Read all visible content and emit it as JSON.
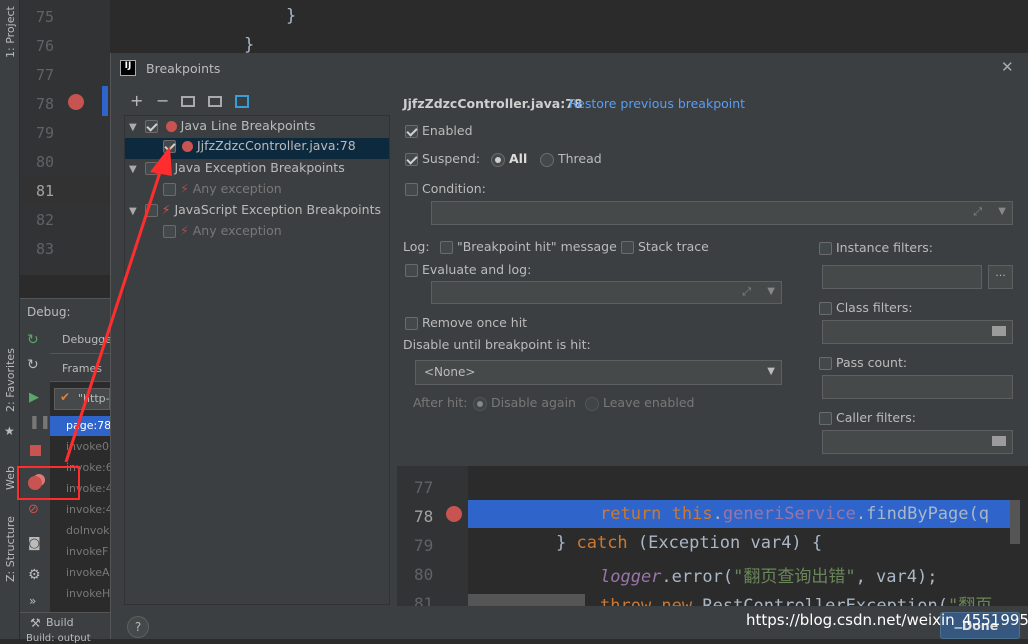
{
  "ide": {
    "left_tabs": [
      "1: Project",
      "2: Favorites",
      "Web",
      "Z: Structure"
    ],
    "gutter_lines": [
      "75",
      "76",
      "77",
      "78",
      "79",
      "80",
      "81",
      "82",
      "83"
    ],
    "editor_lines": [
      "}",
      "}"
    ],
    "debug_label": "Debug:",
    "debug_tabs": [
      "Debugger",
      "Frames"
    ],
    "thread": "\"http-",
    "frames": [
      "page:78",
      "invoke0",
      "invoke:6",
      "invoke:4",
      "invoke:4",
      "doInvok",
      "invokeF",
      "invokeA",
      "invokeH"
    ],
    "bottom": {
      "build": "Build",
      "build_out": "Build: output"
    }
  },
  "dialog": {
    "title": "Breakpoints",
    "toolbar": [
      "+",
      "−"
    ],
    "tree": [
      {
        "label": "Java Line Breakpoints",
        "checked": true
      },
      {
        "label": "JjfzZdzcController.java:78",
        "checked": true,
        "selected": true
      },
      {
        "label": "Java Exception Breakpoints",
        "checked": false
      },
      {
        "label": "Any exception",
        "checked": false
      },
      {
        "label": "JavaScript Exception Breakpoints",
        "checked": false
      },
      {
        "label": "Any exception",
        "checked": false
      }
    ],
    "header_file": "JjfzZdzcController.java:78",
    "restore_link": "Restore previous breakpoint",
    "enabled": "Enabled",
    "suspend": "Suspend:",
    "suspend_all": "All",
    "suspend_thread": "Thread",
    "condition": "Condition:",
    "log": "Log:",
    "log_message": "\"Breakpoint hit\" message",
    "stack_trace": "Stack trace",
    "evaluate_log": "Evaluate and log:",
    "remove_once": "Remove once hit",
    "disable_until": "Disable until breakpoint is hit:",
    "none_option": "<None>",
    "after_hit": "After hit:",
    "disable_again": "Disable again",
    "leave_enabled": "Leave enabled",
    "instance_filters": "Instance filters:",
    "class_filters": "Class filters:",
    "pass_count": "Pass count:",
    "caller_filters": "Caller filters:",
    "ellipsis": "...",
    "help": "?",
    "done": "Done",
    "code_lines": [
      "77",
      "78",
      "79",
      "80",
      "81"
    ],
    "code": {
      "l78": [
        "return ",
        "this",
        ".",
        "generiService",
        ".findByPage(q"
      ],
      "l79": [
        "} ",
        "catch",
        " (Exception var4) {"
      ],
      "l80": [
        "logger",
        ".error(",
        "\"翻页查询出错\"",
        ", var4);"
      ],
      "l81": [
        "throw new ",
        "RestControllerException(",
        "\"翻页"
      ]
    }
  },
  "watermark": "https://blog.csdn.net/weixin_45519956",
  "colors": {
    "selection": "#0d293e",
    "accent_blue": "#2f65ca",
    "link": "#589df6",
    "annotation": "#ff2d2d"
  }
}
